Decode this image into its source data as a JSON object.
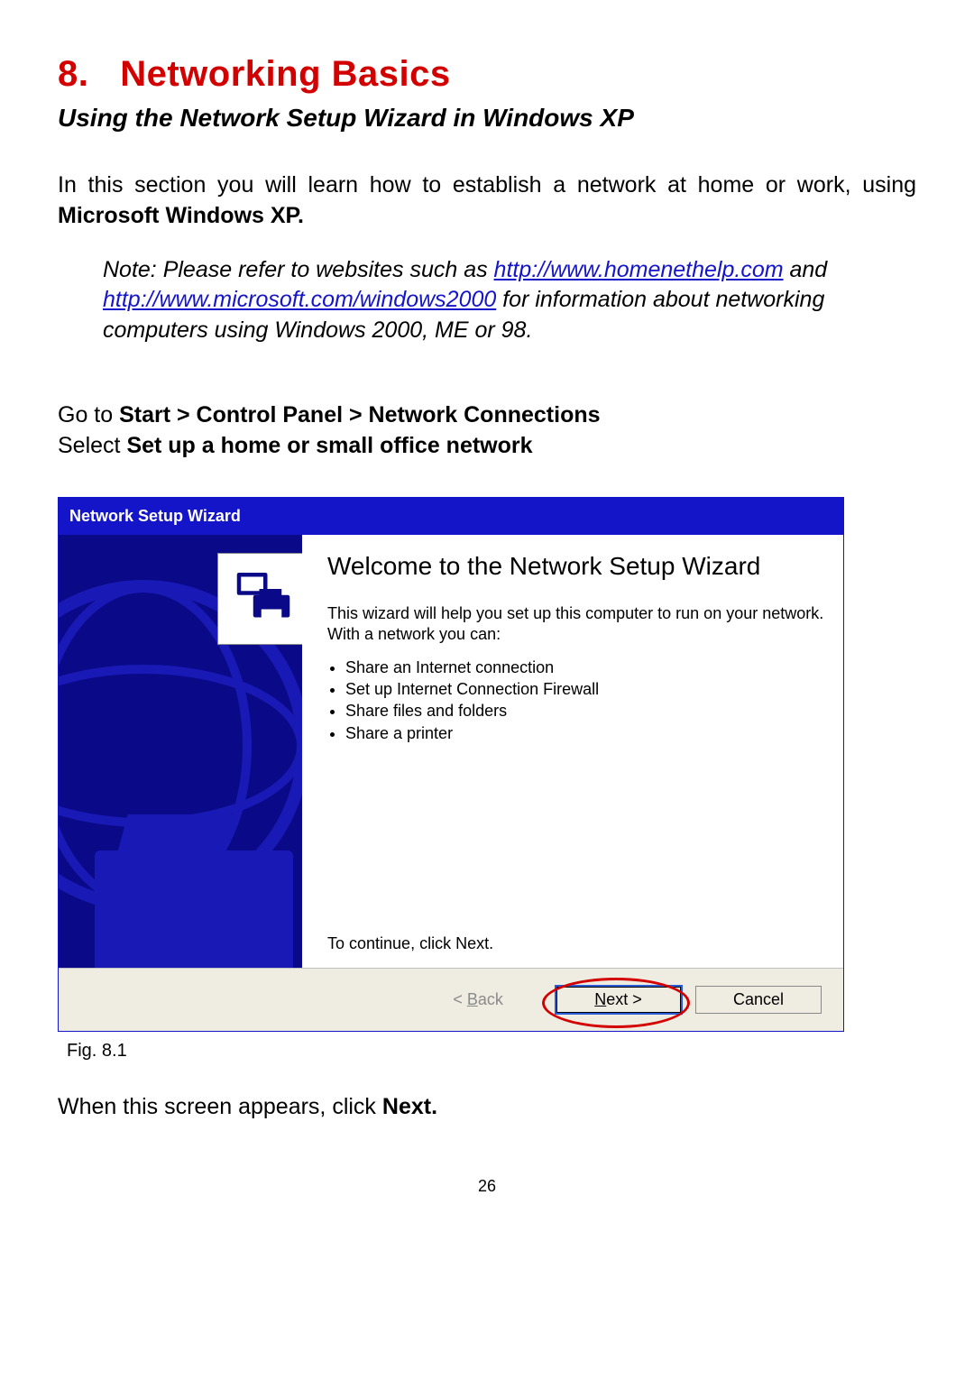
{
  "section": {
    "number": "8.",
    "title": "Networking Basics",
    "subtitle": "Using the Network Setup Wizard in Windows XP"
  },
  "intro": {
    "text_a": "In this section you will learn how to establish a network at home or work, using ",
    "bold_a": "Microsoft Windows XP."
  },
  "note": {
    "prefix": "Note:  Please refer to websites such as ",
    "link1": "http://www.homenethelp.com",
    "mid1": " and ",
    "link2": "http://www.microsoft.com/windows2000",
    "suffix": "  for information about networking computers using Windows 2000, ME or 98."
  },
  "instructions": {
    "line1_a": "Go to ",
    "line1_b": "Start > Control Panel > Network Connections",
    "line2_a": "Select ",
    "line2_b": "Set up a home or small office network"
  },
  "wizard": {
    "title": "Network Setup Wizard",
    "welcome": "Welcome to the Network Setup Wizard",
    "intro": "This wizard will help you set up this computer to run on your network. With a network you can:",
    "bullets": [
      "Share an Internet connection",
      "Set up Internet Connection Firewall",
      "Share files and folders",
      "Share a printer"
    ],
    "continue": "To continue, click Next.",
    "buttons": {
      "back": "< Back",
      "next": "Next >",
      "cancel": "Cancel"
    }
  },
  "figure_caption": "Fig. 8.1",
  "closing": {
    "a": "When this screen appears, click ",
    "b": "Next."
  },
  "page_number": "26"
}
